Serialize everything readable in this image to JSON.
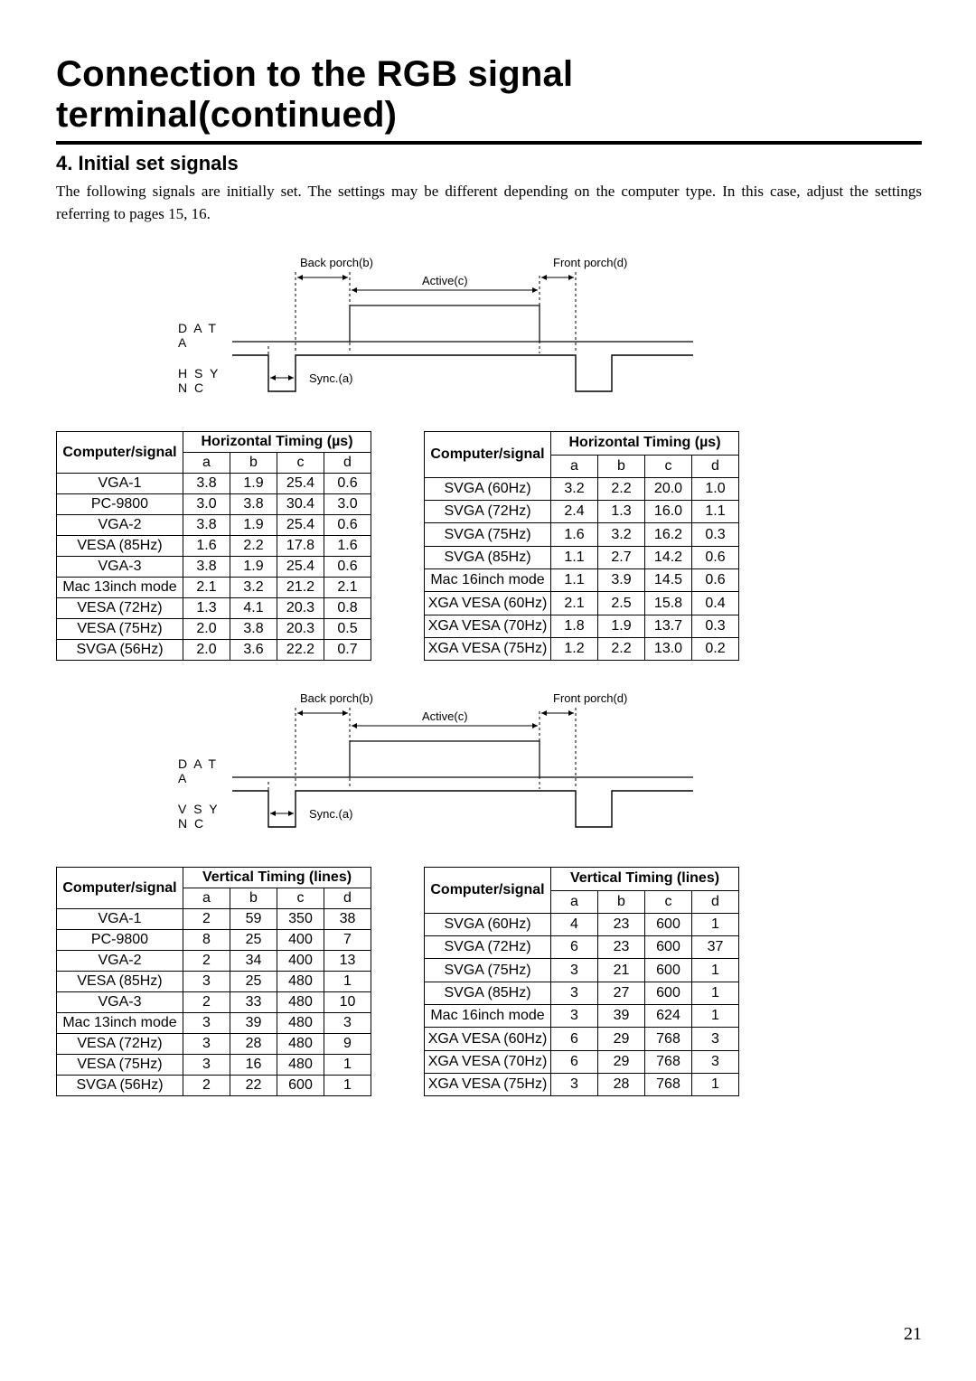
{
  "title": "Connection to the RGB signal terminal(continued)",
  "section_heading": "4. Initial set signals",
  "intro": "The following signals are initially set. The settings may be different depending on the computer type. In this case, adjust the settings referring to pages 15, 16.",
  "page_number": "21",
  "diagram_labels": {
    "back_porch": "Back porch(b)",
    "front_porch": "Front porch(d)",
    "active": "Active(c)",
    "sync": "Sync.(a)",
    "data": "D A T A",
    "hsync": "H S Y N C",
    "vsync": "V S Y N C"
  },
  "table_headers": {
    "cs": "Computer/signal",
    "horiz": "Horizontal Timing (µs)",
    "vert": "Vertical Timing (lines)",
    "a": "a",
    "b": "b",
    "c": "c",
    "d": "d"
  },
  "horiz_left": [
    {
      "name": "VGA-1",
      "a": "3.8",
      "b": "1.9",
      "c": "25.4",
      "d": "0.6"
    },
    {
      "name": "PC-9800",
      "a": "3.0",
      "b": "3.8",
      "c": "30.4",
      "d": "3.0"
    },
    {
      "name": "VGA-2",
      "a": "3.8",
      "b": "1.9",
      "c": "25.4",
      "d": "0.6"
    },
    {
      "name": "VESA (85Hz)",
      "a": "1.6",
      "b": "2.2",
      "c": "17.8",
      "d": "1.6"
    },
    {
      "name": "VGA-3",
      "a": "3.8",
      "b": "1.9",
      "c": "25.4",
      "d": "0.6"
    },
    {
      "name": "Mac 13inch mode",
      "a": "2.1",
      "b": "3.2",
      "c": "21.2",
      "d": "2.1"
    },
    {
      "name": "VESA (72Hz)",
      "a": "1.3",
      "b": "4.1",
      "c": "20.3",
      "d": "0.8"
    },
    {
      "name": "VESA (75Hz)",
      "a": "2.0",
      "b": "3.8",
      "c": "20.3",
      "d": "0.5"
    },
    {
      "name": "SVGA (56Hz)",
      "a": "2.0",
      "b": "3.6",
      "c": "22.2",
      "d": "0.7"
    }
  ],
  "horiz_right": [
    {
      "name": "SVGA (60Hz)",
      "a": "3.2",
      "b": "2.2",
      "c": "20.0",
      "d": "1.0"
    },
    {
      "name": "SVGA (72Hz)",
      "a": "2.4",
      "b": "1.3",
      "c": "16.0",
      "d": "1.1"
    },
    {
      "name": "SVGA (75Hz)",
      "a": "1.6",
      "b": "3.2",
      "c": "16.2",
      "d": "0.3"
    },
    {
      "name": "SVGA (85Hz)",
      "a": "1.1",
      "b": "2.7",
      "c": "14.2",
      "d": "0.6"
    },
    {
      "name": "Mac 16inch mode",
      "a": "1.1",
      "b": "3.9",
      "c": "14.5",
      "d": "0.6"
    },
    {
      "name": "XGA VESA (60Hz)",
      "a": "2.1",
      "b": "2.5",
      "c": "15.8",
      "d": "0.4"
    },
    {
      "name": "XGA VESA (70Hz)",
      "a": "1.8",
      "b": "1.9",
      "c": "13.7",
      "d": "0.3"
    },
    {
      "name": "XGA VESA (75Hz)",
      "a": "1.2",
      "b": "2.2",
      "c": "13.0",
      "d": "0.2"
    }
  ],
  "vert_left": [
    {
      "name": "VGA-1",
      "a": "2",
      "b": "59",
      "c": "350",
      "d": "38"
    },
    {
      "name": "PC-9800",
      "a": "8",
      "b": "25",
      "c": "400",
      "d": "7"
    },
    {
      "name": "VGA-2",
      "a": "2",
      "b": "34",
      "c": "400",
      "d": "13"
    },
    {
      "name": "VESA (85Hz)",
      "a": "3",
      "b": "25",
      "c": "480",
      "d": "1"
    },
    {
      "name": "VGA-3",
      "a": "2",
      "b": "33",
      "c": "480",
      "d": "10"
    },
    {
      "name": "Mac 13inch mode",
      "a": "3",
      "b": "39",
      "c": "480",
      "d": "3"
    },
    {
      "name": "VESA (72Hz)",
      "a": "3",
      "b": "28",
      "c": "480",
      "d": "9"
    },
    {
      "name": "VESA (75Hz)",
      "a": "3",
      "b": "16",
      "c": "480",
      "d": "1"
    },
    {
      "name": "SVGA (56Hz)",
      "a": "2",
      "b": "22",
      "c": "600",
      "d": "1"
    }
  ],
  "vert_right": [
    {
      "name": "SVGA (60Hz)",
      "a": "4",
      "b": "23",
      "c": "600",
      "d": "1"
    },
    {
      "name": "SVGA (72Hz)",
      "a": "6",
      "b": "23",
      "c": "600",
      "d": "37"
    },
    {
      "name": "SVGA (75Hz)",
      "a": "3",
      "b": "21",
      "c": "600",
      "d": "1"
    },
    {
      "name": "SVGA (85Hz)",
      "a": "3",
      "b": "27",
      "c": "600",
      "d": "1"
    },
    {
      "name": "Mac 16inch mode",
      "a": "3",
      "b": "39",
      "c": "624",
      "d": "1"
    },
    {
      "name": "XGA VESA (60Hz)",
      "a": "6",
      "b": "29",
      "c": "768",
      "d": "3"
    },
    {
      "name": "XGA VESA (70Hz)",
      "a": "6",
      "b": "29",
      "c": "768",
      "d": "3"
    },
    {
      "name": "XGA VESA (75Hz)",
      "a": "3",
      "b": "28",
      "c": "768",
      "d": "1"
    }
  ]
}
